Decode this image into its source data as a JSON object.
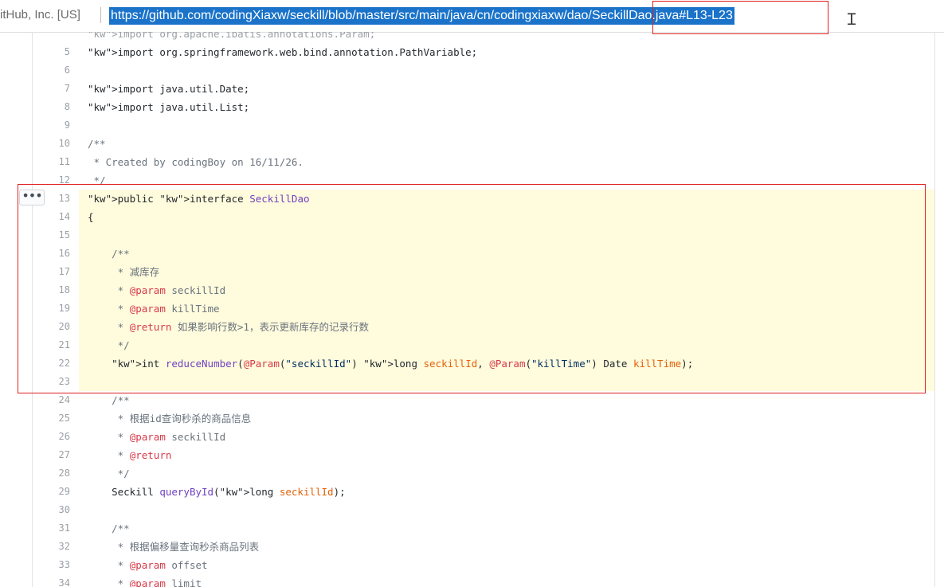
{
  "address_bar": {
    "cert_label": "itHub, Inc. [US]",
    "url": "https://github.com/codingXiaxw/seckill/blob/master/src/main/java/cn/codingxiaxw/dao/SeckillDao.java#L13-L23"
  },
  "more_button_label": "•••",
  "code_lines": [
    {
      "n": "",
      "text": "import org.apache.ibatis.annotations.Param;",
      "partial": true
    },
    {
      "n": "5",
      "text": "import org.springframework.web.bind.annotation.PathVariable;"
    },
    {
      "n": "6",
      "text": ""
    },
    {
      "n": "7",
      "text": "import java.util.Date;"
    },
    {
      "n": "8",
      "text": "import java.util.List;"
    },
    {
      "n": "9",
      "text": ""
    },
    {
      "n": "10",
      "text": "/**"
    },
    {
      "n": "11",
      "text": " * Created by codingBoy on 16/11/26."
    },
    {
      "n": "12",
      "text": " */"
    },
    {
      "n": "13",
      "text": "public interface SeckillDao",
      "hl": true
    },
    {
      "n": "14",
      "text": "{",
      "hl": true
    },
    {
      "n": "15",
      "text": "",
      "hl": true
    },
    {
      "n": "16",
      "text": "    /**",
      "hl": true
    },
    {
      "n": "17",
      "text": "     * 减库存",
      "hl": true
    },
    {
      "n": "18",
      "text": "     * @param seckillId",
      "hl": true
    },
    {
      "n": "19",
      "text": "     * @param killTime",
      "hl": true
    },
    {
      "n": "20",
      "text": "     * @return 如果影响行数>1，表示更新库存的记录行数",
      "hl": true
    },
    {
      "n": "21",
      "text": "     */",
      "hl": true
    },
    {
      "n": "22",
      "text": "    int reduceNumber(@Param(\"seckillId\") long seckillId, @Param(\"killTime\") Date killTime);",
      "hl": true
    },
    {
      "n": "23",
      "text": "",
      "hl": true
    },
    {
      "n": "24",
      "text": "    /**"
    },
    {
      "n": "25",
      "text": "     * 根据id查询秒杀的商品信息"
    },
    {
      "n": "26",
      "text": "     * @param seckillId"
    },
    {
      "n": "27",
      "text": "     * @return"
    },
    {
      "n": "28",
      "text": "     */"
    },
    {
      "n": "29",
      "text": "    Seckill queryById(long seckillId);"
    },
    {
      "n": "30",
      "text": ""
    },
    {
      "n": "31",
      "text": "    /**"
    },
    {
      "n": "32",
      "text": "     * 根据偏移量查询秒杀商品列表"
    },
    {
      "n": "33",
      "text": "     * @param offset"
    },
    {
      "n": "34",
      "text": "     * @param limit"
    }
  ],
  "colors": {
    "highlight_bg": "#fffbdd",
    "selection_box": "#e02020",
    "url_selection": "#1a73c9",
    "keyword": "#d73a49",
    "comment": "#6a737d",
    "function": "#6f42c1"
  }
}
